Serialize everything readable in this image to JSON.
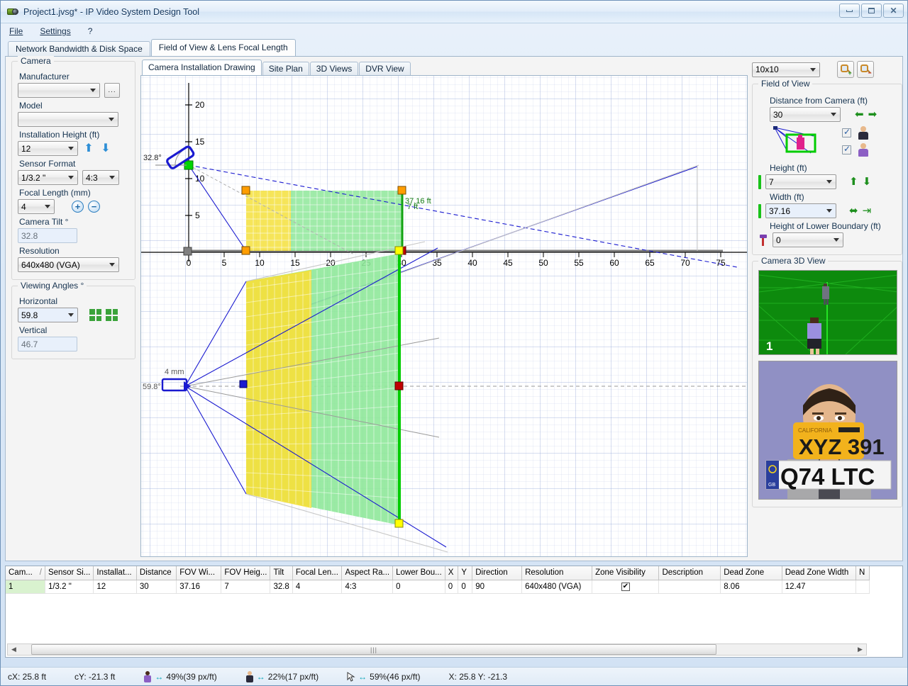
{
  "window": {
    "title": "Project1.jvsg* - IP Video System Design Tool",
    "icon": "camera-icon",
    "minimize": "−",
    "maximize": "▫",
    "close": "✕"
  },
  "menu": {
    "items": [
      {
        "label": "File"
      },
      {
        "label": "Settings"
      },
      {
        "label": "?"
      }
    ]
  },
  "outer_tabs": [
    {
      "label": "Network Bandwidth & Disk Space",
      "active": false
    },
    {
      "label": "Field of View & Lens Focal Length",
      "active": true
    }
  ],
  "inner_tabs": [
    {
      "label": "Camera Installation Drawing",
      "active": true
    },
    {
      "label": "Site Plan",
      "active": false
    },
    {
      "label": "3D Views",
      "active": false
    },
    {
      "label": "DVR View",
      "active": false
    }
  ],
  "left_panel": {
    "camera_group": {
      "legend": "Camera",
      "manufacturer_label": "Manufacturer",
      "manufacturer_value": "",
      "browse_label": "...",
      "model_label": "Model",
      "model_value": "",
      "install_height_label": "Installation Height (ft)",
      "install_height_value": "12",
      "sensor_format_label": "Sensor Format",
      "sensor_format_value": "1/3.2 \"",
      "aspect_ratio_value": "4:3",
      "focal_length_label": "Focal Length (mm)",
      "focal_length_value": "4",
      "camera_tilt_label": "Camera Tilt °",
      "camera_tilt_value": "32.8",
      "resolution_label": "Resolution",
      "resolution_value": "640x480 (VGA)"
    },
    "viewing_angles_group": {
      "legend": "Viewing Angles °",
      "horizontal_label": "Horizontal",
      "horizontal_value": "59.8",
      "vertical_label": "Vertical",
      "vertical_value": "46.7"
    }
  },
  "right_panel": {
    "grid_size_value": "10x10",
    "zoom_in": "zoom-in-icon",
    "zoom_out": "zoom-out-icon",
    "fov_group": {
      "legend": "Field of View",
      "distance_label": "Distance from Camera  (ft)",
      "distance_value": "30",
      "height_label": "Height (ft)",
      "height_value": "7",
      "width_label": "Width (ft)",
      "width_value": "37.16",
      "lower_boundary_label": "Height of Lower Boundary (ft)",
      "lower_boundary_value": "0",
      "show_man_checked": true,
      "show_woman_checked": true
    },
    "camera_3d_view": {
      "legend": "Camera 3D View",
      "badge": "1"
    },
    "preview": {
      "plate_top_text": "XYZ 391",
      "plate_top_region": "CALIFORNIA",
      "plate_bottom_text": "Q74 LTC"
    }
  },
  "drawing": {
    "tilt_label": "32.8°",
    "height_dim_label": "7 ft",
    "focal_label": "4 mm",
    "hfov_label": "59.8°",
    "width_dim_label": "37.16 ft",
    "elevation_y_ticks": [
      "5",
      "10",
      "15",
      "20"
    ],
    "elevation_x_ticks": [
      "0",
      "5",
      "10",
      "15",
      "20",
      "25",
      "30",
      "35",
      "40",
      "45",
      "50",
      "55",
      "60",
      "65",
      "70",
      "75"
    ]
  },
  "table": {
    "headers": [
      "Cam...",
      "Sensor Si...",
      "Installat...",
      "Distance",
      "FOV Wi...",
      "FOV Heig...",
      "Tilt",
      "Focal Len...",
      "Aspect Ra...",
      "Lower Bou...",
      "X",
      "Y",
      "Direction",
      "Resolution",
      "Zone Visibility",
      "Description",
      "Dead Zone",
      "Dead Zone Width",
      "N"
    ],
    "sort_indicator": "/",
    "rows": [
      {
        "cells": [
          "1",
          "1/3.2 \"",
          "12",
          "30",
          "37.16",
          "7",
          "32.8",
          "4",
          "4:3",
          "0",
          "0",
          "0",
          "90",
          "640x480 (VGA)",
          "✔",
          "",
          "8.06",
          "12.47",
          ""
        ]
      }
    ],
    "add_button": "+",
    "remove_button": "−"
  },
  "statusbar": {
    "cx": "cX: 25.8 ft",
    "cy": "cY: -21.3 ft",
    "woman_px": "49%(39 px/ft)",
    "man_px": "22%(17 px/ft)",
    "plate_px": "59%(46 px/ft)",
    "coords": "X: 25.8 Y: -21.3"
  },
  "colors": {
    "identification_yellow": "#f5e03c",
    "recognition_green": "#8fe89a",
    "fov_line_blue": "#1a1ad0",
    "dimension_green": "#00cc00",
    "accent_blue": "#2e8fd6"
  }
}
